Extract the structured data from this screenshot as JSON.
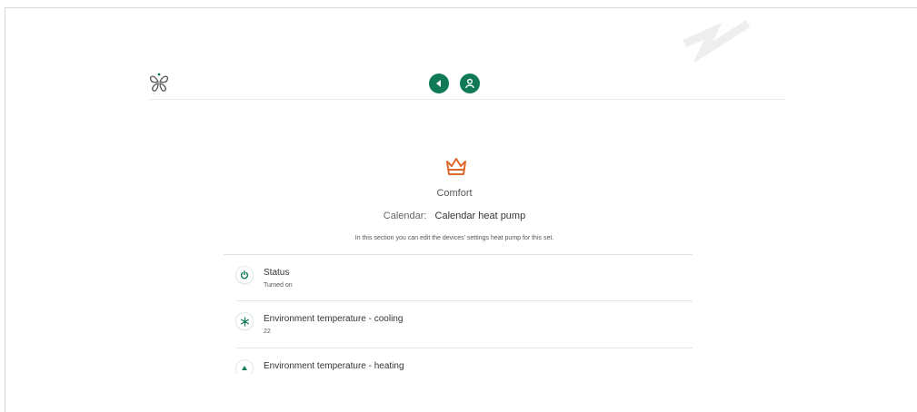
{
  "header": {
    "logo_icon": "butterfly-logo-icon",
    "back_icon": "back-arrow-icon",
    "user_icon": "user-icon",
    "accent_color": "#0f7a55"
  },
  "mode": {
    "icon": "crown-icon",
    "icon_color": "#e0672b",
    "name": "Comfort"
  },
  "calendar": {
    "label": "Calendar:",
    "value": "Calendar heat pump"
  },
  "hint": "In this section you can edit the devices' settings heat pump for this set.",
  "settings": [
    {
      "icon": "power-icon",
      "title": "Status",
      "value": "Turned on"
    },
    {
      "icon": "snowflake-icon",
      "title": "Environment temperature - cooling",
      "value": "22"
    },
    {
      "icon": "arrow-up-icon",
      "title": "Environment temperature - heating",
      "value": ""
    }
  ]
}
